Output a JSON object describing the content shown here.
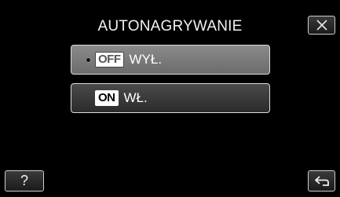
{
  "header": {
    "title": "AUTONAGRYWANIE",
    "close_icon": "close-icon"
  },
  "options": [
    {
      "badge": "OFF",
      "label": "WYŁ.",
      "selected": true
    },
    {
      "badge": "ON",
      "label": "WŁ.",
      "selected": false
    }
  ],
  "footer": {
    "help_label": "?",
    "back_icon": "back-arrow-icon"
  },
  "colors": {
    "background": "#000000",
    "selected_option": "#7a7a7a",
    "normal_option": "#3a3a3a",
    "text": "#ffffff"
  }
}
